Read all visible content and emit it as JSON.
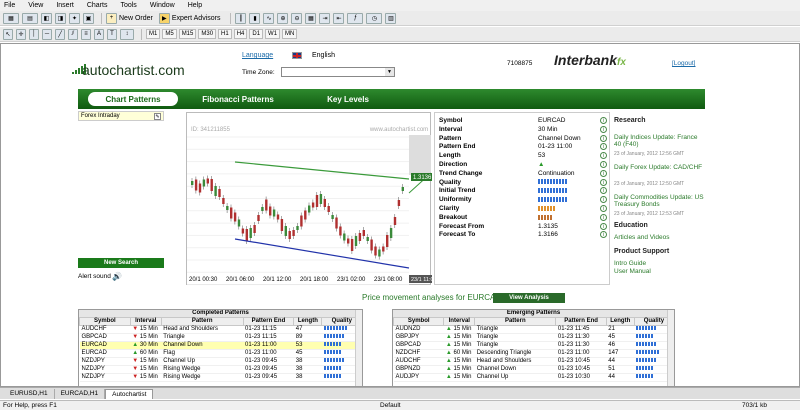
{
  "menu": [
    "File",
    "View",
    "Insert",
    "Charts",
    "Tools",
    "Window",
    "Help"
  ],
  "toolbar": {
    "new_order": "New Order",
    "expert_advisors": "Expert Advisors"
  },
  "timeframes": [
    "M1",
    "M5",
    "M15",
    "M30",
    "H1",
    "H4",
    "D1",
    "W1",
    "MN"
  ],
  "header": {
    "logo": "autochartist.com",
    "language_label": "Language",
    "language_value": "English",
    "timezone_label": "Time Zone:",
    "account_id": "7108875",
    "broker": "Interbank",
    "logout": "[Logout]"
  },
  "tabs": [
    "Chart Patterns",
    "Fibonacci Patterns",
    "Key Levels"
  ],
  "sidebar": {
    "filter": "Forex Intraday",
    "new_search": "New Search",
    "alert_sound": "Alert sound"
  },
  "chart": {
    "id_label": "ID: 341211855",
    "watermark": "www.autochartist.com",
    "price_ticks": [
      "1.3169",
      "1.3159",
      "1.3149",
      "1.3139",
      "1.3129",
      "1.3119",
      "1.3109",
      "1.3099",
      "1.3089",
      "1.3079",
      "1.3069",
      "1.3059",
      "1.3049"
    ],
    "price_current": "1.3136",
    "time_ticks": [
      "20/1 00:30",
      "20/1 06:00",
      "20/1 12:00",
      "20/1 18:00",
      "23/1 02:00",
      "23/1 08:00"
    ],
    "time_current": "23/1 11:00"
  },
  "chart_data": {
    "type": "candlestick",
    "ylim": [
      1.3045,
      1.3172
    ],
    "x": [
      "20/1 00:30",
      "20/1 06:00",
      "20/1 12:00",
      "20/1 18:00",
      "23/1 02:00",
      "23/1 08:00"
    ],
    "price_current": 1.3136
  },
  "info": [
    {
      "k": "Symbol",
      "v": "EURCAD"
    },
    {
      "k": "Interval",
      "v": "30 Min"
    },
    {
      "k": "Pattern",
      "v": "Channel Down"
    },
    {
      "k": "Pattern End",
      "v": "01-23 11:00"
    },
    {
      "k": "Length",
      "v": "53"
    },
    {
      "k": "Direction",
      "v": "▲"
    },
    {
      "k": "Trend Change",
      "v": "Continuation"
    },
    {
      "k": "Quality",
      "v": ""
    },
    {
      "k": "Initial Trend",
      "v": ""
    },
    {
      "k": "Uniformity",
      "v": ""
    },
    {
      "k": "Clarity",
      "v": ""
    },
    {
      "k": "Breakout",
      "v": ""
    },
    {
      "k": "Forecast From",
      "v": "1.3135"
    },
    {
      "k": "Forecast To",
      "v": "1.3166"
    }
  ],
  "research": {
    "title": "Research",
    "items": [
      {
        "t": "Daily Indices Update: France 40 (F40)",
        "d": "23 of January, 2012 12:56 GMT"
      },
      {
        "t": "Daily Forex Update: CAD/CHF",
        "d": "23 of January, 2012 12:50 GMT"
      },
      {
        "t": "Daily Commodities Update: US Treasury Bonds",
        "d": "23 of January, 2012 12:53 GMT"
      }
    ],
    "education": "Education",
    "edu_link": "Articles and Videos",
    "support": "Product Support",
    "sup_links": [
      "Intro Guide",
      "User Manual"
    ]
  },
  "pm": {
    "text": "Price movement analyses for EURCAD",
    "btn": "View Analysis"
  },
  "completed": {
    "title": "Completed Patterns",
    "cols": [
      "Symbol",
      "Interval",
      "Pattern",
      "Pattern End",
      "Length",
      "Quality"
    ],
    "rows": [
      {
        "s": "AUDCHF",
        "d": "dn",
        "i": "15 Min",
        "p": "Head and Shoulders",
        "e": "01-23 11:15",
        "l": "47",
        "q": 8
      },
      {
        "s": "GBPCAD",
        "d": "dn",
        "i": "15 Min",
        "p": "Triangle",
        "e": "01-23 11:15",
        "l": "89",
        "q": 7
      },
      {
        "s": "EURCAD",
        "d": "up",
        "i": "30 Min",
        "p": "Channel Down",
        "e": "01-23 11:00",
        "l": "53",
        "q": 6,
        "hl": true
      },
      {
        "s": "EURCAD",
        "d": "up",
        "i": "60 Min",
        "p": "Flag",
        "e": "01-23 11:00",
        "l": "45",
        "q": 6
      },
      {
        "s": "NZDJPY",
        "d": "dn",
        "i": "15 Min",
        "p": "Channel Up",
        "e": "01-23 09:45",
        "l": "38",
        "q": 7
      },
      {
        "s": "NZDJPY",
        "d": "dn",
        "i": "15 Min",
        "p": "Rising Wedge",
        "e": "01-23 09:45",
        "l": "38",
        "q": 6
      },
      {
        "s": "NZDJPY",
        "d": "dn",
        "i": "15 Min",
        "p": "Rising Wedge",
        "e": "01-23 09:45",
        "l": "38",
        "q": 6
      }
    ]
  },
  "emerging": {
    "title": "Emerging Patterns",
    "cols": [
      "Symbol",
      "Interval",
      "Pattern",
      "Pattern End",
      "Length",
      "Quality"
    ],
    "rows": [
      {
        "s": "AUDNZD",
        "d": "up",
        "i": "15 Min",
        "p": "Triangle",
        "e": "01-23 11:45",
        "l": "21",
        "q": 7
      },
      {
        "s": "GBPJPY",
        "d": "up",
        "i": "15 Min",
        "p": "Triangle",
        "e": "01-23 11:30",
        "l": "45",
        "q": 6
      },
      {
        "s": "GBPCAD",
        "d": "up",
        "i": "15 Min",
        "p": "Triangle",
        "e": "01-23 11:30",
        "l": "46",
        "q": 7
      },
      {
        "s": "NZDCHF",
        "d": "up",
        "i": "60 Min",
        "p": "Descending Triangle",
        "e": "01-23 11:00",
        "l": "147",
        "q": 8
      },
      {
        "s": "AUDCHF",
        "d": "up",
        "i": "15 Min",
        "p": "Head and Shoulders",
        "e": "01-23 10:45",
        "l": "44",
        "q": 7
      },
      {
        "s": "GBPNZD",
        "d": "up",
        "i": "15 Min",
        "p": "Channel Down",
        "e": "01-23 10:45",
        "l": "51",
        "q": 6
      },
      {
        "s": "AUDJPY",
        "d": "up",
        "i": "15 Min",
        "p": "Channel Up",
        "e": "01-23 10:30",
        "l": "44",
        "q": 6
      }
    ]
  },
  "bottom_tabs": [
    "EURUSD,H1",
    "EURCAD,H1",
    "Autochartist"
  ],
  "status": {
    "help": "For Help, press F1",
    "profile": "Default",
    "traffic": "703/1 kb"
  }
}
